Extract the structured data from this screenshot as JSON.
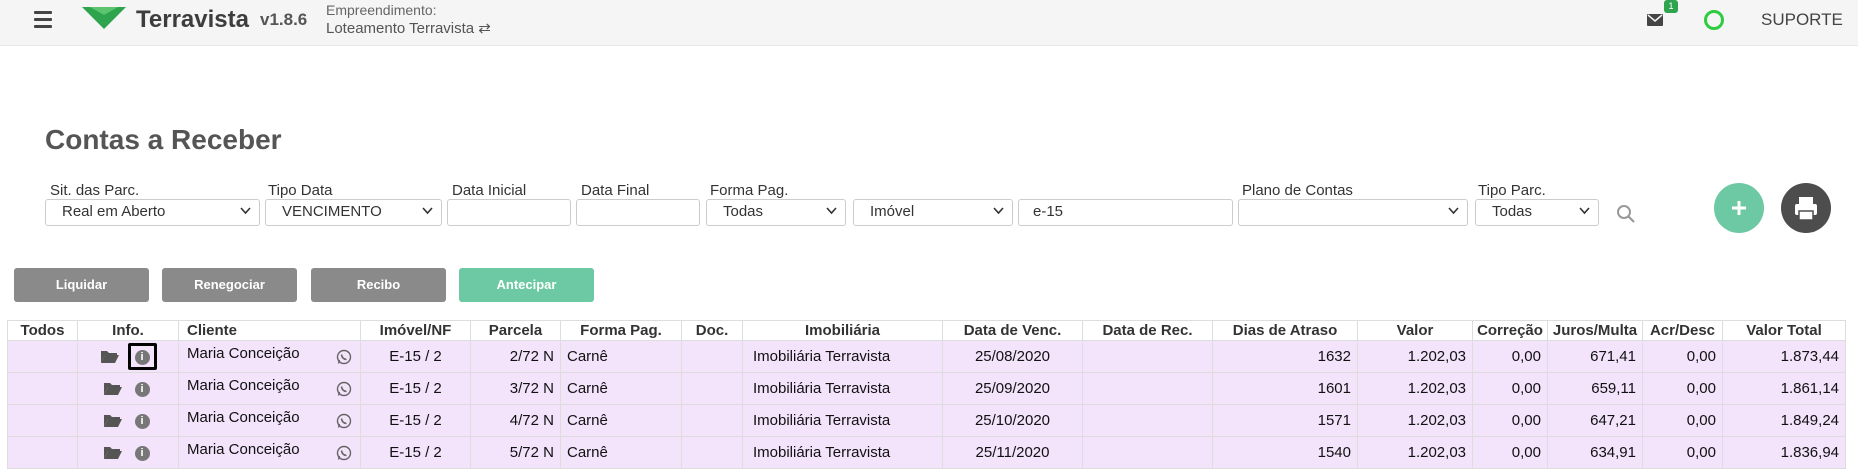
{
  "header": {
    "brand": "Terravista",
    "version": "v1.8.6",
    "empreendimento_label": "Empreendimento:",
    "empreendimento_value": "Loteamento Terravista ⇄",
    "mail_badge": "1",
    "support": "SUPORTE",
    "colors": {
      "brand_green": "#2ea44f",
      "status_green": "#2ecc40"
    }
  },
  "page": {
    "title": "Contas a Receber"
  },
  "filters": {
    "sit_parc": {
      "label": "Sit. das Parc.",
      "value": "Real em Aberto"
    },
    "tipo_data": {
      "label": "Tipo Data",
      "value": "VENCIMENTO"
    },
    "data_inicial": {
      "label": "Data Inicial",
      "value": ""
    },
    "data_final": {
      "label": "Data Final",
      "value": ""
    },
    "forma_pag": {
      "label": "Forma Pag.",
      "value": "Todas"
    },
    "imovel": {
      "value": "Imóvel"
    },
    "search_text": {
      "value": "e-15"
    },
    "plano_contas": {
      "label": "Plano de Contas",
      "value": ""
    },
    "tipo_parc": {
      "label": "Tipo Parc.",
      "value": "Todas"
    }
  },
  "actions": {
    "liquidar": "Liquidar",
    "renegociar": "Renegociar",
    "recibo": "Recibo",
    "antecipar": "Antecipar",
    "colors": {
      "gray": "#8a8a8a",
      "green": "#6cc9a3",
      "print": "#4d4d4d"
    }
  },
  "table": {
    "columns": [
      "Todos",
      "Info.",
      "Cliente",
      "Imóvel/NF",
      "Parcela",
      "Forma Pag.",
      "Doc.",
      "Imobiliária",
      "Data de Venc.",
      "Data de Rec.",
      "Dias de Atraso",
      "Valor",
      "Correção",
      "Juros/Multa",
      "Acr/Desc",
      "Valor Total"
    ],
    "rows": [
      {
        "cliente": "Maria Conceição",
        "imovel": "E-15 / 2",
        "parcela": "2/72 N",
        "forma": "Carnê",
        "doc": "",
        "imobiliaria": "Imobiliária Terravista",
        "venc": "25/08/2020",
        "rec": "",
        "dias": "1632",
        "valor": "1.202,03",
        "correcao": "0,00",
        "juros": "671,41",
        "acr": "0,00",
        "total": "1.873,44"
      },
      {
        "cliente": "Maria Conceição",
        "imovel": "E-15 / 2",
        "parcela": "3/72 N",
        "forma": "Carnê",
        "doc": "",
        "imobiliaria": "Imobiliária Terravista",
        "venc": "25/09/2020",
        "rec": "",
        "dias": "1601",
        "valor": "1.202,03",
        "correcao": "0,00",
        "juros": "659,11",
        "acr": "0,00",
        "total": "1.861,14"
      },
      {
        "cliente": "Maria Conceição",
        "imovel": "E-15 / 2",
        "parcela": "4/72 N",
        "forma": "Carnê",
        "doc": "",
        "imobiliaria": "Imobiliária Terravista",
        "venc": "25/10/2020",
        "rec": "",
        "dias": "1571",
        "valor": "1.202,03",
        "correcao": "0,00",
        "juros": "647,21",
        "acr": "0,00",
        "total": "1.849,24"
      },
      {
        "cliente": "Maria Conceição",
        "imovel": "E-15 / 2",
        "parcela": "5/72 N",
        "forma": "Carnê",
        "doc": "",
        "imobiliaria": "Imobiliária Terravista",
        "venc": "25/11/2020",
        "rec": "",
        "dias": "1540",
        "valor": "1.202,03",
        "correcao": "0,00",
        "juros": "634,91",
        "acr": "0,00",
        "total": "1.836,94"
      }
    ],
    "row_color": "#f3e3fb"
  }
}
